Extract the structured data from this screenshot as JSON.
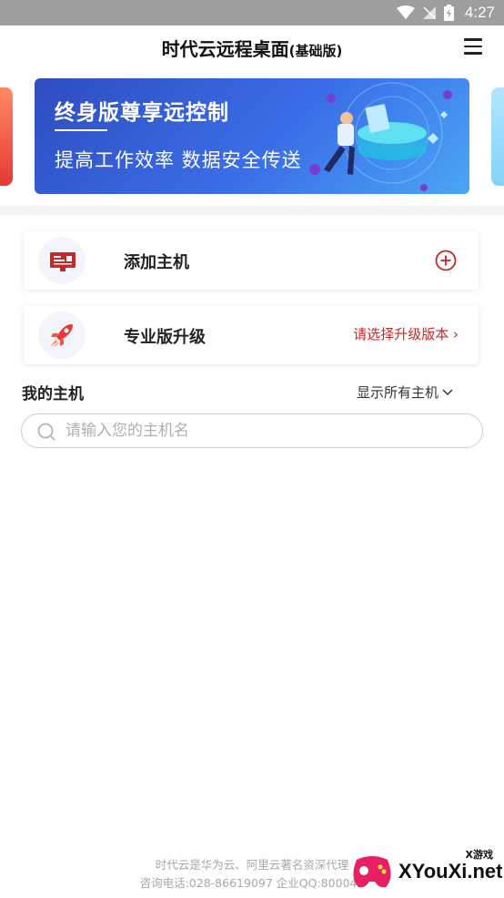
{
  "status_bar": {
    "time": "4:27",
    "icons": [
      "wifi-icon",
      "signal-off-icon",
      "battery-icon"
    ]
  },
  "header": {
    "title": "时代云远程桌面",
    "subtitle": "(基础版)",
    "menu_icon": "hamburger-menu-icon"
  },
  "banner": {
    "title": "终身版尊享远控制",
    "subtitle": "提高工作效率  数据安全传送"
  },
  "cards": {
    "add_host": {
      "label": "添加主机",
      "icon": "host-board-icon",
      "action_icon": "plus-circle-icon"
    },
    "upgrade": {
      "label": "专业版升级",
      "icon": "rocket-icon",
      "action": "请选择升级版本 ›"
    }
  },
  "hosts": {
    "title": "我的主机",
    "filter": "显示所有主机",
    "filter_icon": "chevron-down-icon"
  },
  "search": {
    "placeholder": "请输入您的主机名"
  },
  "footer": {
    "line1": "时代云是华为云、阿里云著名资深代理",
    "line2": "咨询电话:028-86619097 企业QQ:800045"
  },
  "watermark": {
    "text": "XYouXi.net",
    "small": "X游戏"
  },
  "colors": {
    "accent_red": "#c62828",
    "banner_blue": "#3a6ee8",
    "status_bar": "#9e9e9e"
  }
}
